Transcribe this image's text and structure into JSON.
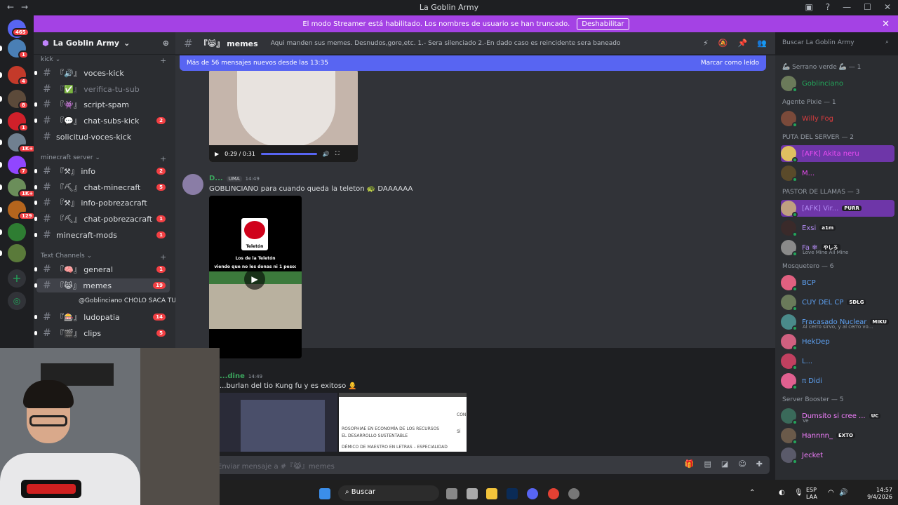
{
  "window": {
    "title": "La Goblin Army"
  },
  "banner": {
    "text": "El modo Streamer está habilitado. Los nombres de usuario se han truncado.",
    "button": "Deshabilitar"
  },
  "guilds": {
    "home_badge": "465",
    "items": [
      {
        "badge": "1",
        "color": "#4a7fb5"
      },
      {
        "badge": "4",
        "color": "#c43a2a"
      },
      {
        "badge": "8",
        "color": "#5c4a3a"
      },
      {
        "badge": "1",
        "color": "#d0202a"
      },
      {
        "badge": "1K+",
        "color": "#708090"
      },
      {
        "badge": "7",
        "color": "#9146ff"
      },
      {
        "badge": "1K+",
        "color": "#6b8e5a"
      },
      {
        "badge": "129",
        "color": "#b5651d"
      },
      {
        "badge": "",
        "color": "#2e7d32"
      },
      {
        "badge": "",
        "color": "#5a7a3a"
      }
    ]
  },
  "server": {
    "name": "La Goblin Army"
  },
  "categories": {
    "kick": "kick",
    "minecraft": "minecraft server",
    "text": "Text Channels"
  },
  "channels": [
    {
      "prefix": "『🔊』",
      "name": "voces-kick",
      "badge": ""
    },
    {
      "prefix": "『✅』",
      "name": "verifica-tu-sub",
      "badge": ""
    },
    {
      "prefix": "『👾』",
      "name": "script-spam",
      "badge": ""
    },
    {
      "prefix": "『💬』",
      "name": "chat-subs-kick",
      "badge": "2"
    },
    {
      "prefix": "",
      "name": "solicitud-voces-kick",
      "badge": ""
    },
    {
      "prefix": "『⚒』",
      "name": "info",
      "badge": "2"
    },
    {
      "prefix": "『⛏』",
      "name": "chat-minecraft",
      "badge": "5"
    },
    {
      "prefix": "『⚒』",
      "name": "info-pobrezacraft",
      "badge": ""
    },
    {
      "prefix": "『⛏』",
      "name": "chat-pobrezacraft",
      "badge": "1"
    },
    {
      "prefix": "",
      "name": "minecraft-mods",
      "badge": "1"
    },
    {
      "prefix": "『🧠』",
      "name": "general",
      "badge": "1"
    },
    {
      "prefix": "『😹』",
      "name": "memes",
      "badge": "19"
    },
    {
      "prefix": "『🎰』",
      "name": "ludopatia",
      "badge": "14"
    },
    {
      "prefix": "『🎬』",
      "name": "clips",
      "badge": "5"
    }
  ],
  "thread": {
    "text": "@Goblinciano CHOLO SACA TU PRUE..."
  },
  "channel_header": {
    "prefix": "『😹』",
    "name": "memes",
    "topic": "Aqui manden sus memes. Desnudos,gore,etc. 1.- Sera silenciado 2.-En dado caso es reincidente sera baneado",
    "search_placeholder": "Buscar La Goblin Army"
  },
  "new_messages": {
    "text": "Más de 56 mensajes nuevos desde las 13:35",
    "mark_read": "Marcar como leído"
  },
  "video1": {
    "time": "0:29 / 0:31"
  },
  "messages": [
    {
      "user": "D...",
      "tag": "UMA",
      "time": "14:49",
      "text": "GOBLINCIANO para cuando queda la teleton 🐢 DAAAAAA"
    },
    {
      "user": "...dine",
      "time": "14:49",
      "text": "...burlan del tio Kung fu y es exitoso 🧑‍🦲"
    }
  ],
  "video2": {
    "caption1": "Los de la Teletón",
    "caption2": "viendo que no les donas ni 1 peso:",
    "logo": "Teletón"
  },
  "img4_rows": [
    "ROSOPHIAE EN ECONOMÍA DE LOS RECURSOS",
    "EL DESARROLLO SUSTENTABLE",
    "DÉMICO DE MAESTRO EN LETRAS – ESPECIALIDAD",
    "SÍ",
    "CON"
  ],
  "composer": {
    "placeholder": "Enviar mensaje a #『😹』memes"
  },
  "member_groups": [
    {
      "label": "🦾 Serrano verde 🦾 — 1",
      "members": [
        {
          "name": "Goblinciano",
          "color": "#23a55a",
          "av": "#6b7a5a"
        }
      ]
    },
    {
      "label": "Agente Pixie — 1",
      "members": [
        {
          "name": "Willy Fog",
          "color": "#d83c3e",
          "av": "#7a4a3a"
        }
      ]
    },
    {
      "label": "PUTA DEL SERVER — 2",
      "members": [
        {
          "name": "[AFK] Akita neru",
          "color": "#e84bf2",
          "av": "#e0c060"
        },
        {
          "name": "M...",
          "color": "#e84bf2",
          "av": "#5a4a2a"
        }
      ]
    },
    {
      "label": "PASTOR DE LLAMAS — 3",
      "members": [
        {
          "name": "[AFK] Vir...",
          "color": "#b48cf5",
          "av": "#c0a080",
          "tag": "PURR"
        },
        {
          "name": "Exsi",
          "color": "#b48cf5",
          "av": "#3a2a2a",
          "tag": "a1m"
        },
        {
          "name": "Fa ❄",
          "color": "#b48cf5",
          "av": "#8a8a8a",
          "tag": "やしろ",
          "sub": "Love Mine All Mine"
        }
      ]
    },
    {
      "label": "Mosquetero — 6",
      "members": [
        {
          "name": "BCP",
          "color": "#5ea1f2",
          "av": "#e06080"
        },
        {
          "name": "CUY DEL CP",
          "color": "#5ea1f2",
          "av": "#6a7a5a",
          "tag": "SDLG"
        },
        {
          "name": "Fracasado Nuclear",
          "color": "#5ea1f2",
          "av": "#4a8a8a",
          "tag": "MIKU",
          "sub": "Al cerro sirvo, y al cerro vo..."
        },
        {
          "name": "HekDep",
          "color": "#5ea1f2",
          "av": "#d06080"
        },
        {
          "name": "L...",
          "color": "#5ea1f2",
          "av": "#c04060"
        },
        {
          "name": "π Didi",
          "color": "#5ea1f2",
          "av": "#e06090"
        }
      ]
    },
    {
      "label": "Server Booster — 5",
      "members": [
        {
          "name": "Dumsito si cree ...",
          "color": "#f47fff",
          "av": "#3a6a5a",
          "tag": "UC",
          "sub": "Ve"
        },
        {
          "name": "Hannnn_",
          "color": "#f47fff",
          "av": "#6a5a4a",
          "tag": "EXTO"
        },
        {
          "name": "Jecket",
          "color": "#f47fff",
          "av": "#5a5a6a"
        }
      ]
    }
  ],
  "taskbar": {
    "search": "Buscar",
    "lang1": "ESP",
    "lang2": "LAA",
    "time": "14:57",
    "date": "9/4/2026"
  }
}
